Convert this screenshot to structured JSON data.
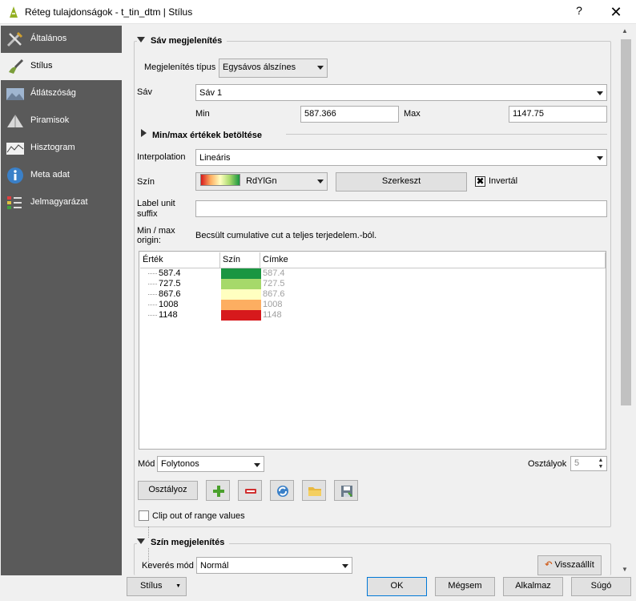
{
  "window": {
    "title": "Réteg tulajdonságok - t_tin_dtm | Stílus",
    "help": "?",
    "close": "✕"
  },
  "sidebar": {
    "items": [
      {
        "label": "Általános",
        "icon": "tools-icon"
      },
      {
        "label": "Stílus",
        "icon": "brush-icon"
      },
      {
        "label": "Átlátszóság",
        "icon": "transparency-icon"
      },
      {
        "label": "Piramisok",
        "icon": "pyramid-icon"
      },
      {
        "label": "Hisztogram",
        "icon": "histogram-icon"
      },
      {
        "label": "Meta adat",
        "icon": "info-icon"
      },
      {
        "label": "Jelmagyarázat",
        "icon": "legend-icon"
      }
    ]
  },
  "band": {
    "header": "Sáv megjelenítés",
    "render_type_label": "Megjelenítés típus",
    "render_type": "Egysávos álszínes",
    "band_label": "Sáv",
    "band_value": "Sáv 1",
    "min_label": "Min",
    "min_value": "587.366",
    "max_label": "Max",
    "max_value": "1147.75",
    "minmax_header": "Min/max értékek betöltése",
    "interp_label": "Interpolation",
    "interp_value": "Lineáris",
    "color_label": "Szín",
    "ramp_name": "RdYlGn",
    "edit_button": "Szerkeszt",
    "invert_label": "Invertál",
    "invert_checked": "✖",
    "unit_label_1": "Label unit",
    "unit_label_2": "suffix",
    "unit_value": "",
    "origin_label_1": "Min / max",
    "origin_label_2": "origin:",
    "origin_value": "Becsült cumulative cut a teljes terjedelem.-ból."
  },
  "table": {
    "headers": [
      "Érték",
      "Szín",
      "Címke"
    ],
    "rows": [
      {
        "value": "587.4",
        "color": "#1a9641",
        "label": "587.4"
      },
      {
        "value": "727.5",
        "color": "#a6d96a",
        "label": "727.5"
      },
      {
        "value": "867.6",
        "color": "#ffffc0",
        "label": "867.6"
      },
      {
        "value": "1008",
        "color": "#fdae61",
        "label": "1008"
      },
      {
        "value": "1148",
        "color": "#d7191c",
        "label": "1148"
      }
    ]
  },
  "mode": {
    "label": "Mód",
    "value": "Folytonos",
    "classes_label": "Osztályok",
    "classes_value": "5"
  },
  "actions": {
    "classify": "Osztályoz",
    "clip_label": "Clip out of range values"
  },
  "color_render": {
    "header": "Szín megjelenítés",
    "blend_label": "Keverés mód",
    "blend_value": "Normál",
    "reset": "Visszaállít"
  },
  "footer": {
    "style": "Stílus",
    "ok": "OK",
    "cancel": "Mégsem",
    "apply": "Alkalmaz",
    "help": "Súgó"
  }
}
